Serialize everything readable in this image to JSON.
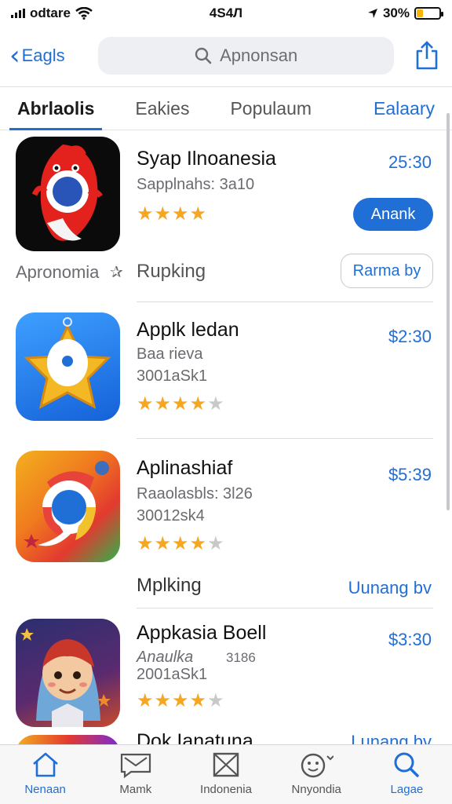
{
  "status_bar": {
    "carrier": "odtare",
    "time": "4S4Л",
    "battery_percent": "30%",
    "battery_level": 0.3
  },
  "nav": {
    "back_label": "Eagls",
    "search_placeholder": "Apnonsan"
  },
  "tabs": [
    {
      "label": "Abrlaolis",
      "active": true
    },
    {
      "label": "Eakies",
      "active": false
    },
    {
      "label": "Populaum",
      "active": false
    },
    {
      "label": "Ealaary",
      "active": false
    }
  ],
  "apps": [
    {
      "title": "Syap Ilnoanesia",
      "subtitle": "Sapplnahs: 3a10",
      "price": "25:30",
      "rating": 4,
      "rating_max": 4,
      "action_label": "Anank",
      "icon_name": "red-mascot-app-icon"
    },
    {
      "title": "Applk ledan",
      "subtitle": "Baa rieva",
      "subtitle2": "3001aSk1",
      "price": "$2:30",
      "rating": 4,
      "rating_max": 5,
      "icon_name": "star-app-icon"
    },
    {
      "title": "Aplinashiaf",
      "subtitle": "Raaolasbls: 3l26",
      "subtitle2": "30012sk4",
      "price": "$5:39",
      "rating": 4,
      "rating_max": 5,
      "icon_name": "chrome-like-app-icon"
    },
    {
      "title": "Appkasia Boell",
      "subtitle": "Anaulka",
      "subtitle_extra": "3186",
      "subtitle2": "2001aSk1",
      "price": "$3:30",
      "rating": 4,
      "rating_max": 5,
      "icon_name": "character-app-icon"
    },
    {
      "title": "Dok Ianatuna",
      "link_label": "Lunang bv",
      "icon_name": "colorful-app-icon"
    }
  ],
  "section_1": {
    "left_label": "Apronomia",
    "label": "Rupking",
    "button_label": "Rarma by"
  },
  "section_2": {
    "label": "Mplking",
    "link_label": "Uunang bv"
  },
  "tabbar": [
    {
      "label": "Nenaan",
      "icon": "home-icon",
      "active": true
    },
    {
      "label": "Mamk",
      "icon": "message-icon",
      "active": false
    },
    {
      "label": "Indonenia",
      "icon": "mail-icon",
      "active": false
    },
    {
      "label": "Nnyondia",
      "icon": "face-icon",
      "active": false
    },
    {
      "label": "Lagae",
      "icon": "search-icon",
      "active": true
    }
  ],
  "colors": {
    "accent": "#1f6fd6",
    "star": "#f5a623",
    "search_bg": "#eeeff2"
  }
}
